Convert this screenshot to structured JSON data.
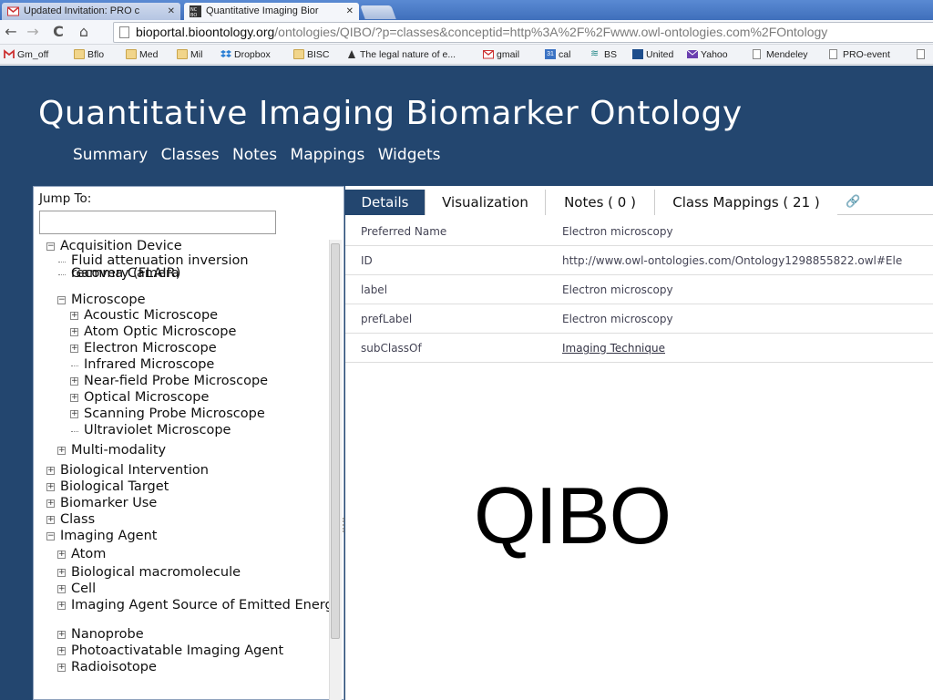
{
  "browser": {
    "tabs": [
      {
        "title": "Updated Invitation: PRO c",
        "icon": "gmail-icon"
      },
      {
        "title": "Quantitative Imaging Bior",
        "icon": "ncbo-icon"
      }
    ],
    "url_host": "bioportal.bioontology.org",
    "url_path": "/ontologies/QIBO/?p=classes&conceptid=http%3A%2F%2Fwww.owl-ontologies.com%2FOntology",
    "bookmarks": [
      {
        "label": "Gm_off",
        "icon": "gmail-icon"
      },
      {
        "label": "Bflo",
        "icon": "folder-icon"
      },
      {
        "label": "Med",
        "icon": "folder-icon"
      },
      {
        "label": "Mil",
        "icon": "folder-icon"
      },
      {
        "label": "Dropbox",
        "icon": "dropbox-icon"
      },
      {
        "label": "BISC",
        "icon": "folder-icon"
      },
      {
        "label": "The legal nature of e...",
        "icon": "page-icon"
      },
      {
        "label": "gmail",
        "icon": "gmail-icon"
      },
      {
        "label": "cal",
        "icon": "calendar-icon"
      },
      {
        "label": "BS",
        "icon": "bs-icon"
      },
      {
        "label": "United",
        "icon": "united-icon"
      },
      {
        "label": "Yahoo",
        "icon": "mail-icon"
      },
      {
        "label": "Mendeley",
        "icon": "page-icon"
      },
      {
        "label": "PRO-event",
        "icon": "page-icon"
      }
    ],
    "calendar_day": "31"
  },
  "site": {
    "title": "Quantitative Imaging Biomarker Ontology",
    "nav": [
      "Summary",
      "Classes",
      "Notes",
      "Mappings",
      "Widgets"
    ]
  },
  "sidebar": {
    "jump_label": "Jump To:",
    "jump_value": "",
    "tree": [
      {
        "label": "Acquisition Device",
        "level": 0,
        "state": "open"
      },
      {
        "label": "Fluid attenuation inversion recovery (FLAIR)",
        "level": 1,
        "state": "leaf"
      },
      {
        "label": "Gamma Camera",
        "level": 1,
        "state": "leaf"
      },
      {
        "label": "Microscope",
        "level": 1,
        "state": "open"
      },
      {
        "label": "Acoustic Microscope",
        "level": 2,
        "state": "closed"
      },
      {
        "label": "Atom Optic Microscope",
        "level": 2,
        "state": "closed"
      },
      {
        "label": "Electron Microscope",
        "level": 2,
        "state": "closed"
      },
      {
        "label": "Infrared Microscope",
        "level": 2,
        "state": "leaf"
      },
      {
        "label": "Near-field Probe Microscope",
        "level": 2,
        "state": "closed"
      },
      {
        "label": "Optical Microscope",
        "level": 2,
        "state": "closed"
      },
      {
        "label": "Scanning Probe Microscope",
        "level": 2,
        "state": "closed"
      },
      {
        "label": "Ultraviolet Microscope",
        "level": 2,
        "state": "leaf"
      },
      {
        "label": "Multi-modality",
        "level": 1,
        "state": "closed"
      },
      {
        "label": "Biological Intervention",
        "level": 0,
        "state": "closed"
      },
      {
        "label": "Biological Target",
        "level": 0,
        "state": "closed"
      },
      {
        "label": "Biomarker Use",
        "level": 0,
        "state": "closed"
      },
      {
        "label": "Class",
        "level": 0,
        "state": "closed"
      },
      {
        "label": "Imaging Agent",
        "level": 0,
        "state": "open"
      },
      {
        "label": "Atom",
        "level": 1,
        "state": "closed"
      },
      {
        "label": "Biological macromolecule",
        "level": 1,
        "state": "closed"
      },
      {
        "label": "Cell",
        "level": 1,
        "state": "closed"
      },
      {
        "label": "Imaging Agent Source of Emitted Energy",
        "level": 1,
        "state": "closed"
      },
      {
        "label": "Nanoprobe",
        "level": 1,
        "state": "closed"
      },
      {
        "label": "Photoactivatable Imaging Agent",
        "level": 1,
        "state": "closed"
      },
      {
        "label": "Radioisotope",
        "level": 1,
        "state": "closed"
      }
    ]
  },
  "content": {
    "tabs": [
      "Details",
      "Visualization",
      "Notes ( 0 )",
      "Class Mappings ( 21 )"
    ],
    "active_tab": "Details",
    "details": [
      {
        "label": "Preferred Name",
        "value": "Electron microscopy",
        "link": false
      },
      {
        "label": "ID",
        "value": "http://www.owl-ontologies.com/Ontology1298855822.owl#Ele",
        "link": false
      },
      {
        "label": "label",
        "value": "Electron microscopy",
        "link": false
      },
      {
        "label": "prefLabel",
        "value": "Electron microscopy",
        "link": false
      },
      {
        "label": "subClassOf",
        "value": "Imaging Technique",
        "link": true
      }
    ]
  },
  "overlay": {
    "text": "QIBO"
  },
  "colors": {
    "header_bg": "#23466f",
    "tab_active_bg": "#23466f",
    "chrome_tabstrip": "#4a7cc6"
  }
}
